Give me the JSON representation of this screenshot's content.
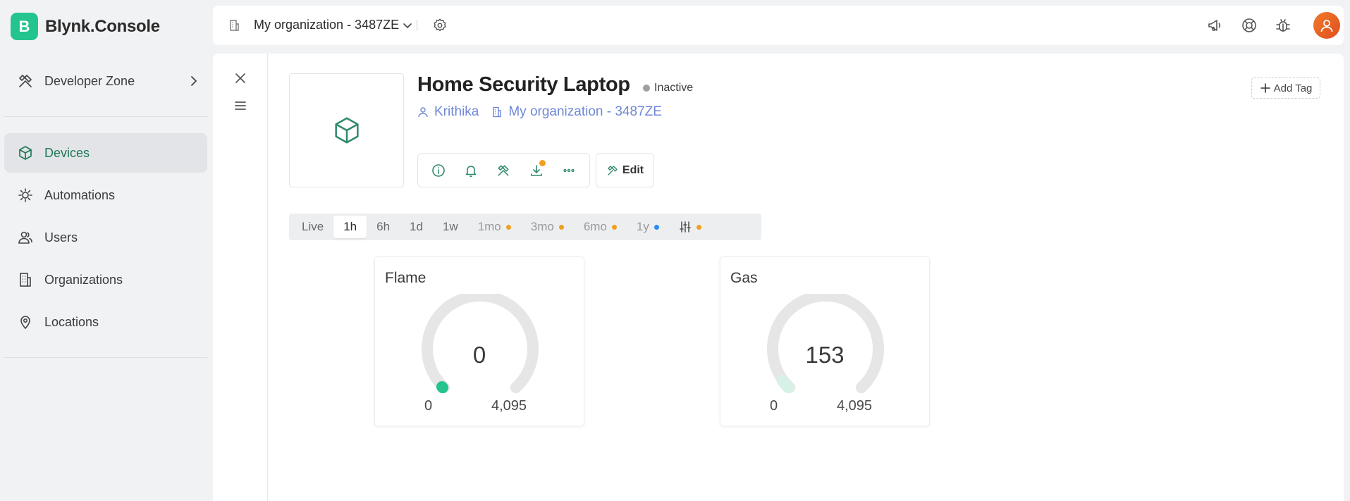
{
  "app": {
    "logo_letter": "B",
    "logo_text": "Blynk.Console"
  },
  "sidebar": {
    "developer_zone": "Developer Zone",
    "items": [
      {
        "label": "Devices",
        "icon": "cube-icon",
        "active": true
      },
      {
        "label": "Automations",
        "icon": "automation-icon"
      },
      {
        "label": "Users",
        "icon": "users-icon"
      },
      {
        "label": "Organizations",
        "icon": "building-icon"
      },
      {
        "label": "Locations",
        "icon": "location-pin-icon"
      }
    ]
  },
  "topbar": {
    "organization": "My organization - 3487ZE",
    "icons": [
      "building-icon",
      "chevron-down-icon",
      "gear-icon",
      "megaphone-icon",
      "help-lifebuoy-icon",
      "bug-icon",
      "avatar"
    ]
  },
  "device": {
    "name": "Home Security Laptop",
    "status": "Inactive",
    "owner": "Krithika",
    "organization": "My organization - 3487ZE",
    "edit_label": "Edit",
    "add_tag_label": "Add Tag",
    "action_icons": [
      "info-icon",
      "bell-icon",
      "tools-icon",
      "download-icon",
      "more-icon"
    ]
  },
  "time_ranges": [
    {
      "label": "Live"
    },
    {
      "label": "1h",
      "active": true
    },
    {
      "label": "6h"
    },
    {
      "label": "1d"
    },
    {
      "label": "1w"
    },
    {
      "label": "1mo",
      "dot": "#f0a020",
      "muted": true
    },
    {
      "label": "3mo",
      "dot": "#f0a020",
      "muted": true
    },
    {
      "label": "6mo",
      "dot": "#f0a020",
      "muted": true
    },
    {
      "label": "1y",
      "dot": "#2a8cf0",
      "muted": true
    }
  ],
  "widgets": [
    {
      "title": "Flame",
      "value": "0",
      "min": "0",
      "max": "4,095",
      "level": 0
    },
    {
      "title": "Gas",
      "value": "153",
      "min": "0",
      "max": "4,095",
      "level": 0.037
    }
  ],
  "colors": {
    "accent": "#23c48e",
    "active_text": "#1e7a57",
    "link": "#6f87d8",
    "badge_orange": "#f0a020",
    "badge_blue": "#2a8cf0",
    "gauge_track": "#e6e6e6"
  }
}
